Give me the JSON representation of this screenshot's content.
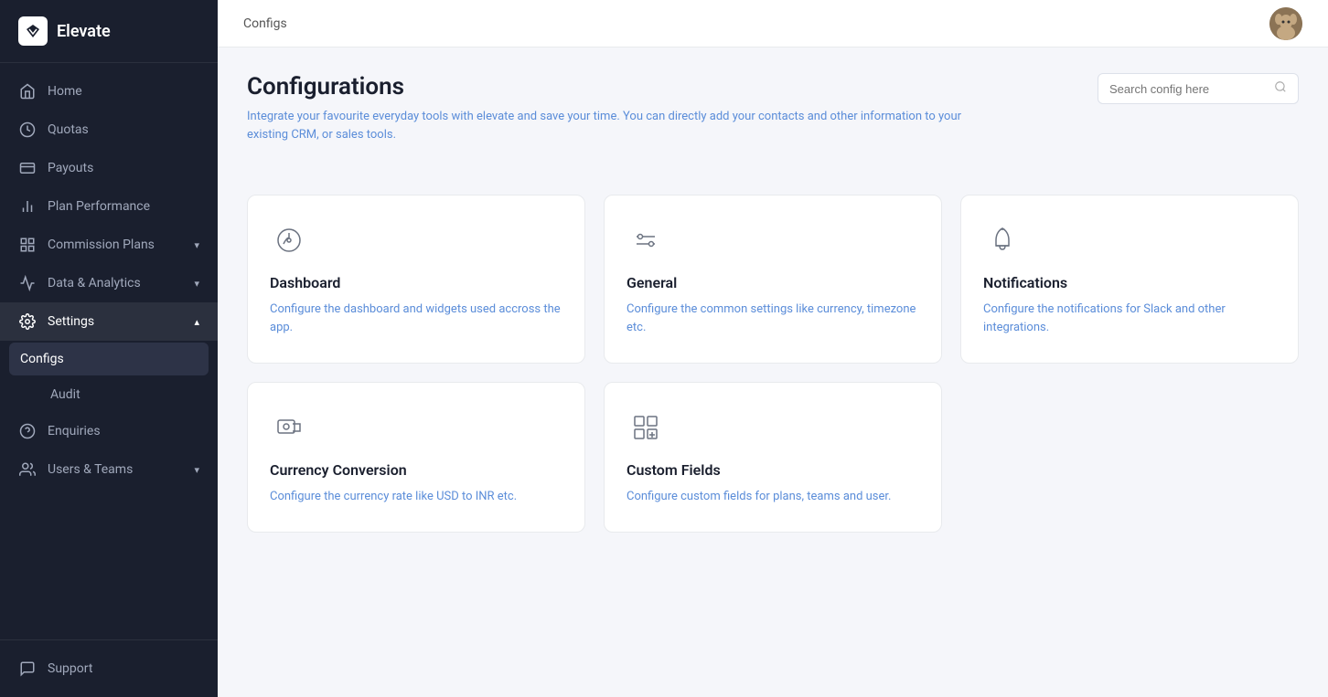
{
  "app": {
    "name": "Elevate"
  },
  "breadcrumb": "Configs",
  "page": {
    "title": "Configurations",
    "subtitle": "Integrate your favourite everyday tools with elevate and save your time. You can directly add your contacts and other information to your existing CRM, or sales tools.",
    "search_placeholder": "Search config here"
  },
  "sidebar": {
    "items": [
      {
        "id": "home",
        "label": "Home",
        "icon": "home-icon",
        "active": false
      },
      {
        "id": "quotas",
        "label": "Quotas",
        "icon": "quotas-icon",
        "active": false
      },
      {
        "id": "payouts",
        "label": "Payouts",
        "icon": "payouts-icon",
        "active": false
      },
      {
        "id": "plan-performance",
        "label": "Plan Performance",
        "icon": "chart-icon",
        "active": false
      },
      {
        "id": "commission-plans",
        "label": "Commission Plans",
        "icon": "commission-icon",
        "active": false,
        "has_chevron": true
      },
      {
        "id": "data-analytics",
        "label": "Data & Analytics",
        "icon": "analytics-icon",
        "active": false,
        "has_chevron": true
      },
      {
        "id": "settings",
        "label": "Settings",
        "icon": "settings-icon",
        "active": true,
        "has_chevron": true
      },
      {
        "id": "configs",
        "label": "Configs",
        "sub": true,
        "active": true
      },
      {
        "id": "audit",
        "label": "Audit",
        "sub": true,
        "active": false
      },
      {
        "id": "enquiries",
        "label": "Enquiries",
        "icon": "enquiries-icon",
        "active": false
      },
      {
        "id": "users-teams",
        "label": "Users & Teams",
        "icon": "users-icon",
        "active": false,
        "has_chevron": true
      }
    ],
    "bottom": [
      {
        "id": "support",
        "label": "Support",
        "icon": "support-icon"
      }
    ]
  },
  "cards": [
    {
      "id": "dashboard",
      "title": "Dashboard",
      "description": "Configure the dashboard and widgets used accross the app.",
      "icon": "dashboard-icon"
    },
    {
      "id": "general",
      "title": "General",
      "description": "Configure the common settings like currency, timezone etc.",
      "icon": "general-icon"
    },
    {
      "id": "notifications",
      "title": "Notifications",
      "description": "Configure the notifications for Slack and other integrations.",
      "icon": "notifications-icon"
    },
    {
      "id": "currency-conversion",
      "title": "Currency Conversion",
      "description": "Configure the currency rate like USD to INR etc.",
      "icon": "currency-icon"
    },
    {
      "id": "custom-fields",
      "title": "Custom Fields",
      "description": "Configure custom fields for plans, teams and user.",
      "icon": "custom-fields-icon"
    }
  ]
}
